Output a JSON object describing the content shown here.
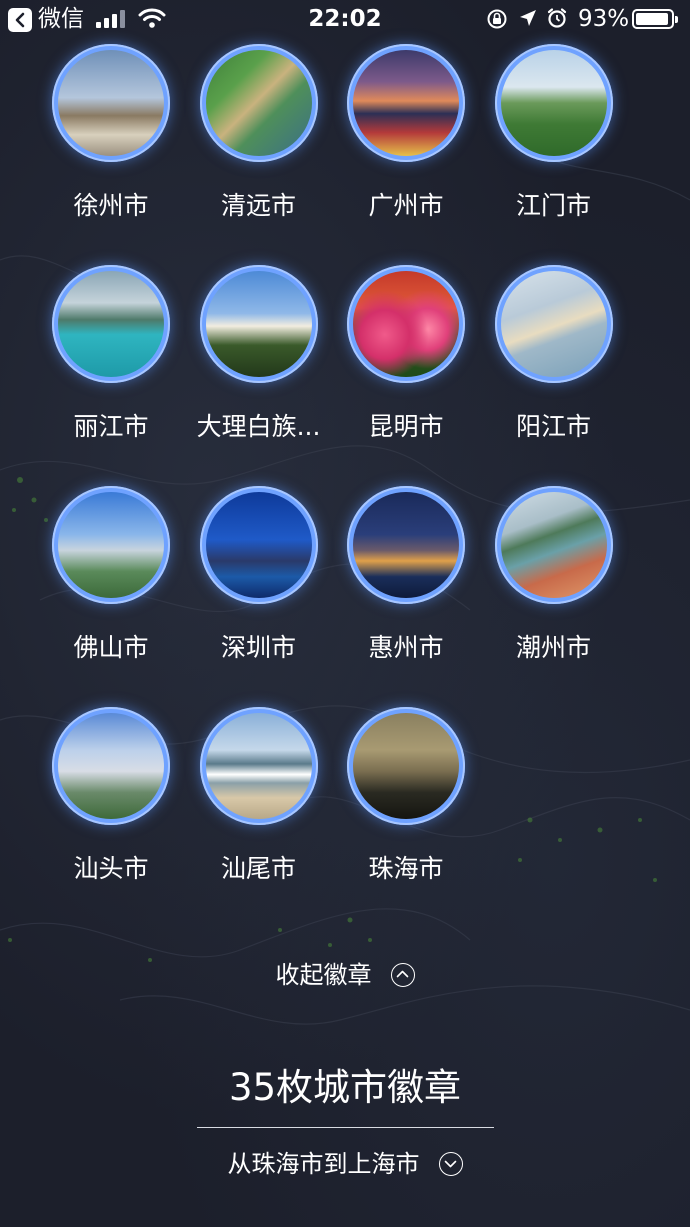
{
  "status_bar": {
    "back_app": "微信",
    "time": "22:02",
    "battery_percent": "93%",
    "battery_level": 0.93,
    "icons": [
      "back-arrow-icon",
      "signal-bars-icon",
      "wifi-icon",
      "rotation-lock-icon",
      "location-arrow-icon",
      "alarm-icon",
      "battery-icon"
    ]
  },
  "badges": [
    {
      "label": "徐州市"
    },
    {
      "label": "清远市"
    },
    {
      "label": "广州市"
    },
    {
      "label": "江门市"
    },
    {
      "label": "丽江市"
    },
    {
      "label": "大理白族..."
    },
    {
      "label": "昆明市"
    },
    {
      "label": "阳江市"
    },
    {
      "label": "佛山市"
    },
    {
      "label": "深圳市"
    },
    {
      "label": "惠州市"
    },
    {
      "label": "潮州市"
    },
    {
      "label": "汕头市"
    },
    {
      "label": "汕尾市"
    },
    {
      "label": "珠海市"
    }
  ],
  "collapse": {
    "label": "收起徽章",
    "icon": "chevron-up-circle-icon"
  },
  "summary": {
    "title": "35枚城市徽章",
    "route": "从珠海市到上海市",
    "route_icon": "chevron-down-circle-icon"
  },
  "colors": {
    "background": "#1c1f2b",
    "badge_ring": "#6fa2ff",
    "text": "#ffffff"
  }
}
